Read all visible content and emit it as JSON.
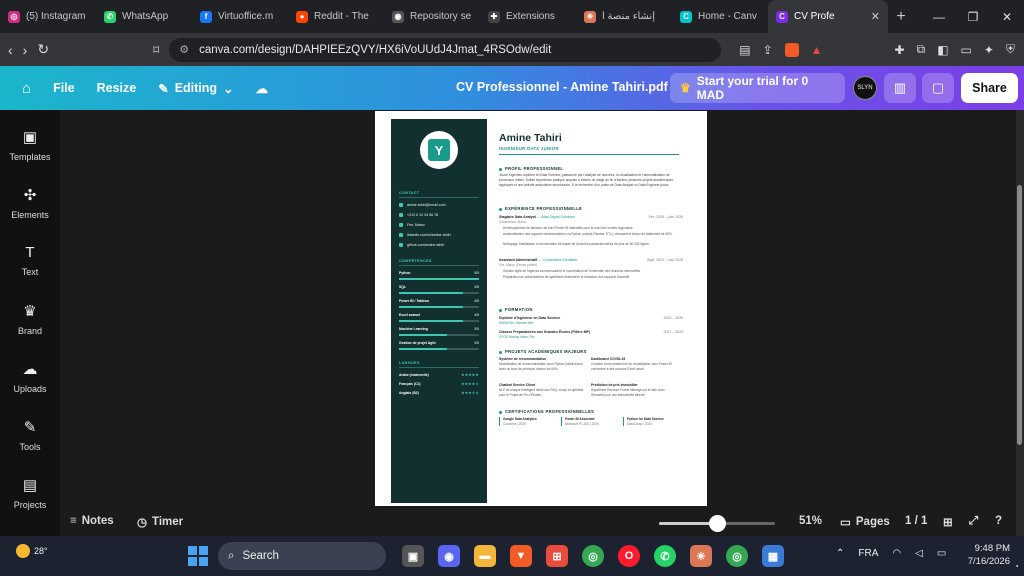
{
  "tabs": [
    {
      "title": "(5) Instagram",
      "fav": "◎",
      "color": "#d6297f"
    },
    {
      "title": "WhatsApp",
      "fav": "✆",
      "color": "#25d366"
    },
    {
      "title": "Virtuoffice.m",
      "fav": "f",
      "color": "#1877f2"
    },
    {
      "title": "Reddit - The",
      "fav": "●",
      "color": "#ff4500"
    },
    {
      "title": "Repository se",
      "fav": "◉",
      "color": "#555"
    },
    {
      "title": "Extensions",
      "fav": "✚",
      "color": "#444"
    },
    {
      "title": "إنشاء منصة ا",
      "fav": "✳",
      "color": "#d97757"
    },
    {
      "title": "Home - Canv",
      "fav": "C",
      "color": "#00c4cc"
    }
  ],
  "active_tab": {
    "title": "CV Profe",
    "fav": "C",
    "color": "#7d2ae8"
  },
  "url": "canva.com/design/DAHPIEEzQVY/HX6iVoUUdJ4Jmat_4RSOdw/edit",
  "brave_badge": "29",
  "toolbar": {
    "file": "File",
    "resize": "Resize",
    "editing": "Editing",
    "doc_title": "CV Professionnel - Amine Tahiri.pdf",
    "trial": "Start your trial for 0 MAD",
    "avatar": "SLYN",
    "share": "Share"
  },
  "sidebar": [
    {
      "label": "Templates",
      "icon": "▣"
    },
    {
      "label": "Elements",
      "icon": "✣"
    },
    {
      "label": "Text",
      "icon": "T"
    },
    {
      "label": "Brand",
      "icon": "♛"
    },
    {
      "label": "Uploads",
      "icon": "☁"
    },
    {
      "label": "Tools",
      "icon": "✎"
    },
    {
      "label": "Projects",
      "icon": "▤"
    }
  ],
  "cv": {
    "name": "Amine Tahiri",
    "role": "INGÉNIEUR DATA JUNIOR",
    "contact_h": "CONTACT",
    "contact": [
      "amine.tahiri@email.com",
      "+212 6 12 34 56 78",
      "Fès, Maroc",
      "linkedin.com/in/amine-tahiri",
      "github.com/amine-tahiri"
    ],
    "skills_h": "COMPÉTENCES",
    "skills": [
      {
        "name": "Python",
        "level": "5/5",
        "pct": 1.0
      },
      {
        "name": "SQL",
        "level": "4/5",
        "pct": 0.8
      },
      {
        "name": "Power BI / Tableau",
        "level": "4/5",
        "pct": 0.8
      },
      {
        "name": "Excel avancé",
        "level": "4/5",
        "pct": 0.8
      },
      {
        "name": "Machine Learning",
        "level": "3/5",
        "pct": 0.6
      },
      {
        "name": "Gestion de projet Agile",
        "level": "3/5",
        "pct": 0.6
      }
    ],
    "langues_h": "LANGUES",
    "langues": [
      {
        "name": "Arabe (maternelle)",
        "stars": "★★★★★"
      },
      {
        "name": "Français (C1)",
        "stars": "★★★★☆"
      },
      {
        "name": "Anglais (B2)",
        "stars": "★★★☆☆"
      }
    ],
    "profil_h": "PROFIL PROFESSIONNEL",
    "profil": "Jeune ingénieur diplômé en Data Science, passionné par l'analyse de données, la visualisation et l'automatisation de processus métier. Solide expérience pratique acquise à travers un stage de fin d'études, plusieurs projets académiques appliqués et une activité associative structurante. À la recherche d'un poste de Data Analyst ou Data Engineer junior.",
    "exp_h": "EXPÉRIENCE PROFESSIONNELLE",
    "jobs": [
      {
        "title": "Stagiaire Data Analyst",
        "company": "— Atlas Digital Solutions",
        "dates": "Fév. 2026 – Juin 2026",
        "place": "Casablanca, Maroc",
        "bullets": [
          "Développement de tableaux de bord Power BI interactifs pour le suivi des ventes régionales.",
          "Automatisation des rapports hebdomadaires via Python (scripts Pandas, ETL), réduisant le temps de traitement de 60%.",
          "Nettoyage, fiabilisation et structuration de bases de données transactionnelles de plus de 50 000 lignes."
        ]
      },
      {
        "title": "Assistant Administratif",
        "company": "— Coopérative Etudiante",
        "dates": "Sept. 2024 – Juin 2025",
        "place": "Fès, Maroc (Temps partiel)",
        "bullets": [
          "Gestion agile de l'agenda communautaire et coordination de l'ensemble des réunions mensuelles.",
          "Préparation de présentations de synthèses financières et rédaction des rapports d'activité."
        ]
      }
    ],
    "form_h": "FORMATION",
    "formation": [
      {
        "title": "Diplôme d'Ingénieur en Data Science",
        "school": "ENSA Fès / Marché Mer",
        "dates": "2023 – 2026"
      },
      {
        "title": "Classes Préparatoires aux Grandes Écoles (Filière MP)",
        "school": "CPGE Moulay Idriss, Fès",
        "dates": "2021 – 2023"
      }
    ],
    "proj_h": "PROJETS ACADÉMIQUES MAJEURS",
    "projets": [
      {
        "title": "Système de recommandation",
        "desc": "Modélisation de recommandation sous Python (scikit-learn) avec un taux de précision obtenu de 84%."
      },
      {
        "title": "Dashboard COVID-19",
        "desc": "Création d'une plateforme de visualisation sous Power BI connectée à des sources Excel clean."
      },
      {
        "title": "Chatbot Service Client",
        "desc": "NLP de lexique intelligent dédié aux FAQ, conçu et optimisé pour le Projet de Fin d'Études."
      },
      {
        "title": "Prédiction de prix immobilier",
        "desc": "Algorithme Random Forest hébergé sur le web sous Streamlit pour une interactivité directe."
      }
    ],
    "cert_h": "CERTIFICATIONS PROFESSIONNELLES",
    "certs": [
      {
        "title": "Google Data Analytics",
        "meta": "Coursera | 2025"
      },
      {
        "title": "Power BI Associate",
        "meta": "Microsoft PL-300 | 2026"
      },
      {
        "title": "Python for Data Science",
        "meta": "DataCamp | 2024"
      }
    ]
  },
  "status": {
    "notes": "Notes",
    "timer": "Timer",
    "zoom": "51%",
    "zoom_fraction": 0.5,
    "pages_label": "Pages",
    "page_count": "1 / 1"
  },
  "taskbar": {
    "temp": "28°",
    "search": "Search",
    "lang": "FRA",
    "time": "9:48 PM",
    "date": "7/16/2026"
  }
}
